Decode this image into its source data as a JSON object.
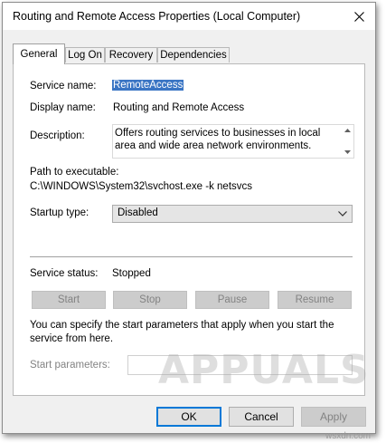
{
  "window": {
    "title": "Routing and Remote Access Properties (Local Computer)"
  },
  "tabs": [
    {
      "label": "General",
      "active": true
    },
    {
      "label": "Log On",
      "active": false
    },
    {
      "label": "Recovery",
      "active": false
    },
    {
      "label": "Dependencies",
      "active": false
    }
  ],
  "general": {
    "service_name_label": "Service name:",
    "service_name_value": "RemoteAccess",
    "display_name_label": "Display name:",
    "display_name_value": "Routing and Remote Access",
    "description_label": "Description:",
    "description_value": "Offers routing services to businesses in local area and wide area network environments.",
    "path_label": "Path to executable:",
    "path_value": "C:\\WINDOWS\\System32\\svchost.exe -k netsvcs",
    "startup_type_label": "Startup type:",
    "startup_type_value": "Disabled",
    "service_status_label": "Service status:",
    "service_status_value": "Stopped",
    "buttons": {
      "start": "Start",
      "stop": "Stop",
      "pause": "Pause",
      "resume": "Resume"
    },
    "start_params_hint": "You can specify the start parameters that apply when you start the service from here.",
    "start_params_label": "Start parameters:",
    "start_params_value": ""
  },
  "dialog_buttons": {
    "ok": "OK",
    "cancel": "Cancel",
    "apply": "Apply"
  },
  "watermark": {
    "brand": "APPUALS",
    "site": "wsxdn.com"
  },
  "colors": {
    "selection": "#3a75c4",
    "default_button_border": "#0078d7"
  }
}
